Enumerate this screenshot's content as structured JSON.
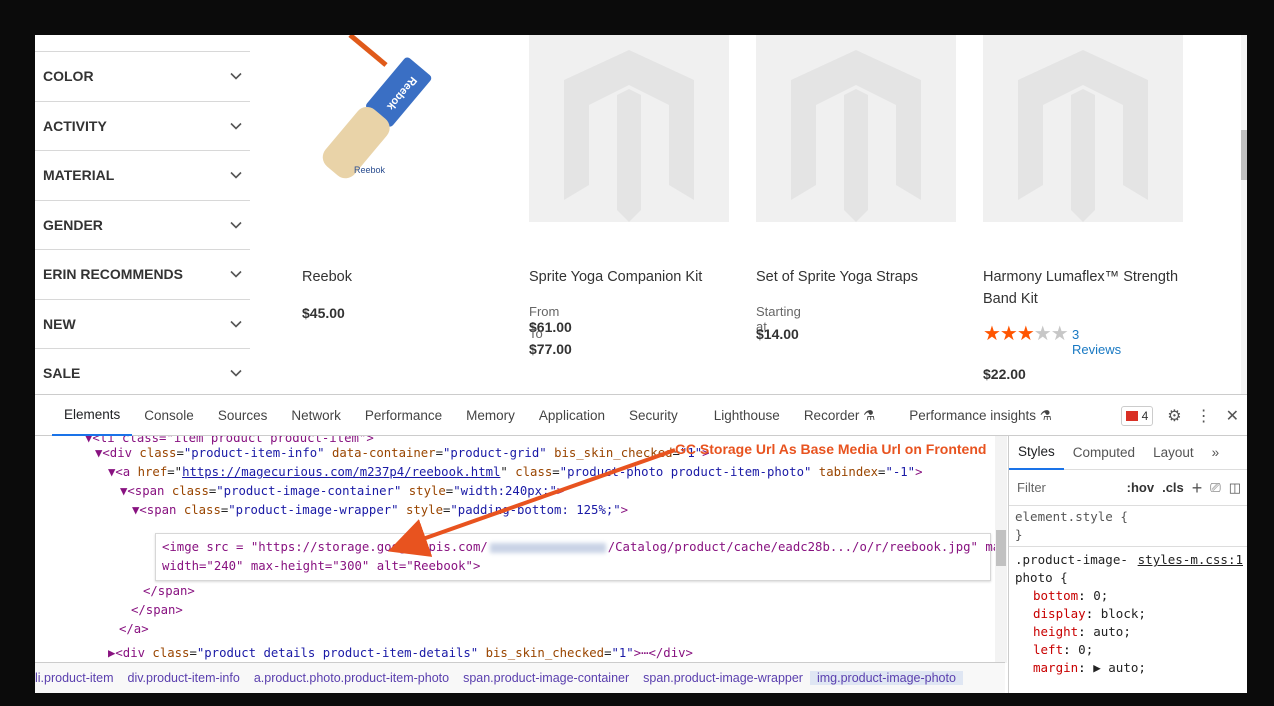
{
  "filters": [
    "COLOR",
    "ACTIVITY",
    "MATERIAL",
    "GENDER",
    "ERIN RECOMMENDS",
    "NEW",
    "SALE"
  ],
  "products": [
    {
      "name": "Reebok",
      "price": "$45.00",
      "brand_text": "Reebok"
    },
    {
      "name": "Sprite Yoga Companion Kit",
      "from_label": "From",
      "from_price": "$61.00",
      "to_label": "To",
      "to_price": "$77.00"
    },
    {
      "name": "Set of Sprite Yoga Straps",
      "starting_label": "Starting at",
      "price": "$14.00"
    },
    {
      "name": "Harmony Lumaflex™ Strength Band Kit",
      "reviews": "3 Reviews",
      "rating": 3,
      "rating_max": 5,
      "price": "$22.00"
    }
  ],
  "devtools": {
    "tabs": [
      "Elements",
      "Console",
      "Sources",
      "Network",
      "Performance",
      "Memory",
      "Application",
      "Security",
      "Lighthouse",
      "Recorder ⚗",
      "Performance insights ⚗"
    ],
    "error_count": "4",
    "annotation": "GC Storage Url As Base Media Url on Frontend",
    "dom": {
      "l0": "▼<li class=\"item product product-item\">",
      "l1_a": "▼<div ",
      "l1_attr1": "class",
      "l1_val1": "\"product-item-info\"",
      "l1_attr2": "data-container",
      "l1_val2": "\"product-grid\"",
      "l1_attr3": "bis_skin_checked",
      "l1_val3": "\"1\"",
      "l1_end": ">",
      "l2_a": "▼<a ",
      "l2_attr1": "href",
      "l2_link": "https://magecurious.com/m237p4/reebook.html",
      "l2_attr2": "class",
      "l2_val2": "\"product-photo product-item-photo\"",
      "l2_attr3": "tabindex",
      "l2_val3": "\"-1\"",
      "l2_end": ">",
      "l3_a": "▼<span ",
      "l3_attr1": "class",
      "l3_val1": "\"product-image-container\"",
      "l3_attr2": "style",
      "l3_val2": "\"width:240px;\"",
      "l3_end": ">",
      "l4_a": "▼<span ",
      "l4_attr1": "class",
      "l4_val1": "\"product-image-wrapper\"",
      "l4_attr2": "style",
      "l4_val2": "\"padding-bottom: 125%;\"",
      "l4_end": ">",
      "img1_a": "<imge src = \"https://storage.googleapis.com/",
      "img1_b": "/Catalog/product/cache/eadc28b.../o/r/reebook.jpg\" max-",
      "img2": "width=\"240\" max-height=\"300\" alt=\"Reebook\">",
      "close_span1": "</span>",
      "close_span2": "</span>",
      "close_a": "</a>",
      "l9_a": "▶<div ",
      "l9_attr1": "class",
      "l9_val1": "\"product details product-item-details\"",
      "l9_attr2": "bis_skin_checked",
      "l9_val2": "\"1\"",
      "l9_end": ">⋯</div>"
    },
    "breadcrumbs": [
      "li.product-item",
      "div.product-item-info",
      "a.product.photo.product-item-photo",
      "span.product-image-container",
      "span.product-image-wrapper",
      "img.product-image-photo"
    ],
    "styles_tabs": [
      "Styles",
      "Computed",
      "Layout",
      "»"
    ],
    "filter_placeholder": "Filter",
    "hov": ":hov",
    "cls": ".cls",
    "element_style": "element.style {",
    "element_close": "}",
    "rule_selector_1": ".product-image-",
    "rule_selector_2": "photo {",
    "rule_source": "styles-m.css:1",
    "rules": [
      {
        "prop": "bottom",
        "val": "0;"
      },
      {
        "prop": "display",
        "val": "block;"
      },
      {
        "prop": "height",
        "val": "auto;"
      },
      {
        "prop": "left",
        "val": "0;"
      },
      {
        "prop": "margin",
        "val": "▶ auto;"
      }
    ]
  },
  "colors": {
    "star": "#ff5501",
    "annotation": "#e8531f",
    "accent": "#1a73e8"
  }
}
